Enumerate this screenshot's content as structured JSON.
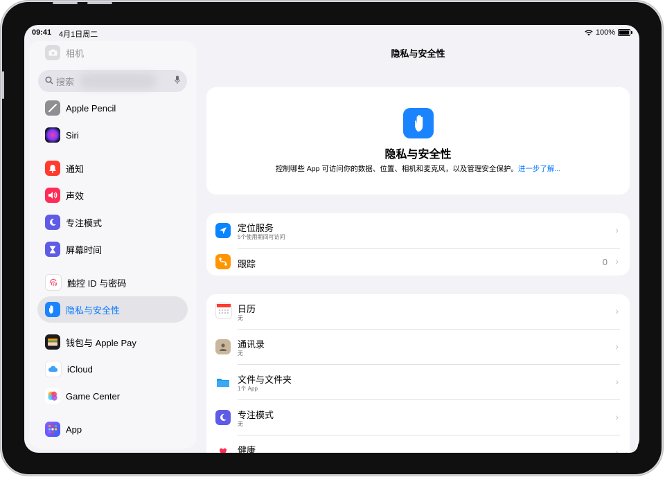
{
  "status_bar": {
    "time": "09:41",
    "date": "4月1日周二",
    "battery": "100%"
  },
  "sidebar": {
    "search_placeholder": "搜索",
    "items": [
      {
        "label": "相机",
        "icon": "camera-icon",
        "color": "#b5b5ba"
      },
      {
        "label": "Apple Pencil",
        "icon": "pencil-icon",
        "color": "#8e8e93"
      },
      {
        "label": "Siri",
        "icon": "siri-icon",
        "color": "#5b2bd8"
      },
      {
        "label": "通知",
        "icon": "bell-icon",
        "color": "#ff3b30"
      },
      {
        "label": "声效",
        "icon": "speaker-icon",
        "color": "#ff2d55"
      },
      {
        "label": "专注模式",
        "icon": "moon-icon",
        "color": "#5e5ce6"
      },
      {
        "label": "屏幕时间",
        "icon": "hourglass-icon",
        "color": "#5e5ce6"
      },
      {
        "label": "触控 ID 与密码",
        "icon": "fingerprint-icon",
        "color": "#ffffff"
      },
      {
        "label": "隐私与安全性",
        "icon": "hand-icon",
        "color": "#1a84ff"
      },
      {
        "label": "钱包与 Apple Pay",
        "icon": "wallet-icon",
        "color": "#1c1c1e"
      },
      {
        "label": "iCloud",
        "icon": "cloud-icon",
        "color": "#ffffff"
      },
      {
        "label": "Game Center",
        "icon": "game-center-icon",
        "color": "#ffffff"
      },
      {
        "label": "App",
        "icon": "apps-grid-icon",
        "color": "#5e5ce6"
      }
    ]
  },
  "main": {
    "title": "隐私与安全性",
    "hero": {
      "title": "隐私与安全性",
      "description": "控制哪些 App 可访问你的数据、位置、相机和麦克风，以及管理安全保护。",
      "link": "进一步了解..."
    },
    "group1": [
      {
        "title": "定位服务",
        "subtitle": "5个使用期间可访问",
        "icon": "location-arrow-icon",
        "color": "#0a84ff"
      },
      {
        "title": "跟踪",
        "value": "0",
        "icon": "tracking-icon",
        "color": "#ff9500"
      }
    ],
    "group2": [
      {
        "title": "日历",
        "subtitle": "无",
        "icon": "calendar-icon",
        "color": "#ffffff"
      },
      {
        "title": "通讯录",
        "subtitle": "无",
        "icon": "contacts-icon",
        "color": "#c9b79c"
      },
      {
        "title": "文件与文件夹",
        "subtitle": "1个 App",
        "icon": "folder-icon",
        "color": "#ffffff"
      },
      {
        "title": "专注模式",
        "subtitle": "无",
        "icon": "moon-icon",
        "color": "#5e5ce6"
      },
      {
        "title": "健康",
        "subtitle": "",
        "icon": "heart-icon",
        "color": "#ffffff"
      }
    ]
  }
}
